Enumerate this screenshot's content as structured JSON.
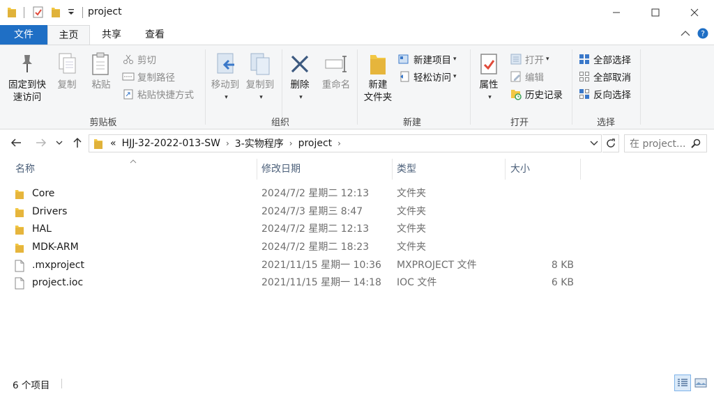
{
  "window": {
    "title": "project"
  },
  "ribbon_tabs": {
    "file": "文件",
    "home": "主页",
    "share": "共享",
    "view": "查看"
  },
  "clipboard": {
    "pin_line1": "固定到快",
    "pin_line2": "速访问",
    "copy": "复制",
    "paste": "粘贴",
    "cut": "剪切",
    "copy_path": "复制路径",
    "paste_shortcut": "粘贴快捷方式",
    "group": "剪贴板"
  },
  "organize": {
    "move_to": "移动到",
    "copy_to": "复制到",
    "delete": "删除",
    "rename": "重命名",
    "group": "组织"
  },
  "new": {
    "new_folder_line1": "新建",
    "new_folder_line2": "文件夹",
    "new_item": "新建项目",
    "easy_access": "轻松访问",
    "group": "新建"
  },
  "open": {
    "properties": "属性",
    "open": "打开",
    "edit": "编辑",
    "history": "历史记录",
    "group": "打开"
  },
  "select": {
    "select_all": "全部选择",
    "select_none": "全部取消",
    "invert": "反向选择",
    "group": "选择"
  },
  "address": {
    "overflow": "«",
    "crumbs": [
      "HJJ-32-2022-013-SW",
      "3-实物程序",
      "project"
    ]
  },
  "search": {
    "placeholder": "在 project..."
  },
  "columns": {
    "name": "名称",
    "date": "修改日期",
    "type": "类型",
    "size": "大小"
  },
  "files": [
    {
      "name": "Core",
      "date": "2024/7/2 星期二 12:13",
      "type": "文件夹",
      "size": "",
      "kind": "folder"
    },
    {
      "name": "Drivers",
      "date": "2024/7/3 星期三 8:47",
      "type": "文件夹",
      "size": "",
      "kind": "folder"
    },
    {
      "name": "HAL",
      "date": "2024/7/2 星期二 12:13",
      "type": "文件夹",
      "size": "",
      "kind": "folder"
    },
    {
      "name": "MDK-ARM",
      "date": "2024/7/2 星期二 18:23",
      "type": "文件夹",
      "size": "",
      "kind": "folder"
    },
    {
      "name": ".mxproject",
      "date": "2021/11/15 星期一 10:36",
      "type": "MXPROJECT 文件",
      "size": "8 KB",
      "kind": "file"
    },
    {
      "name": "project.ioc",
      "date": "2021/11/15 星期一 14:18",
      "type": "IOC 文件",
      "size": "6 KB",
      "kind": "file"
    }
  ],
  "status": {
    "item_count": "6 个项目"
  },
  "colors": {
    "accent": "#1f6fc5",
    "folder": "#f2c744",
    "header_text": "#4c607a"
  }
}
